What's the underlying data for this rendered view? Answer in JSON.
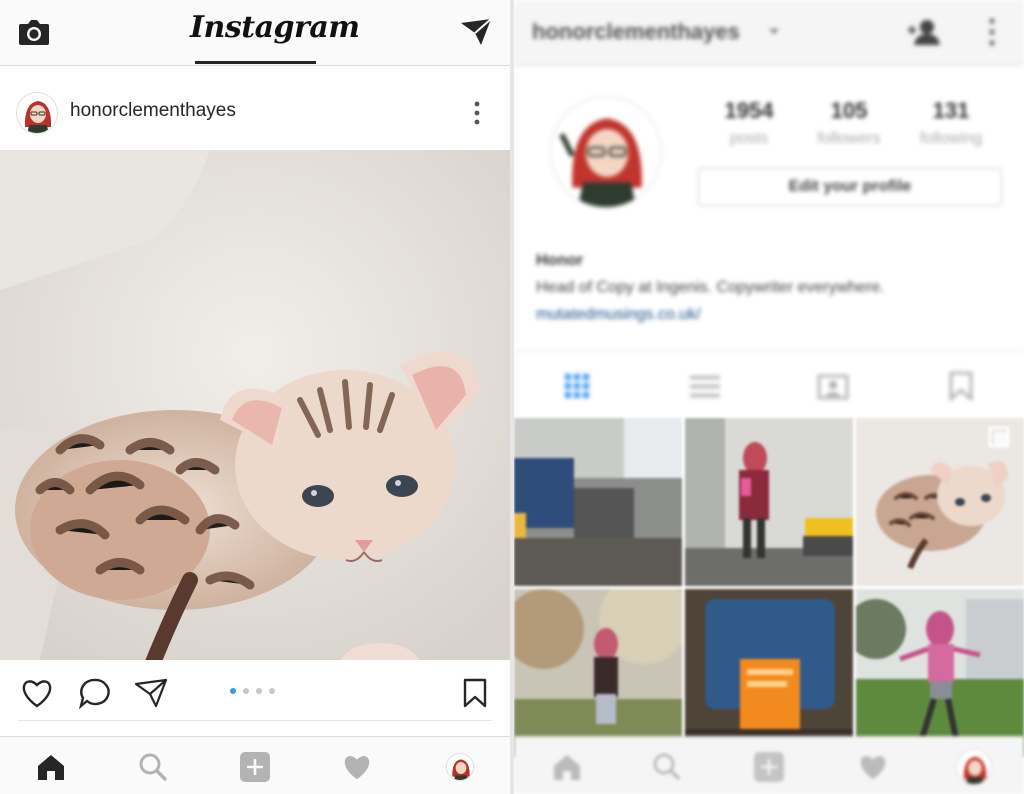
{
  "left_screen": {
    "topbar": {
      "logo_text": "Instagram",
      "left_icon": "camera-icon",
      "right_icon": "direct-send-icon"
    },
    "post": {
      "username": "honorclementhayes",
      "avatar_icon": "profile-avatar",
      "more_icon": "more-vertical-icon",
      "photo_subject": "tabby kitten",
      "actions": [
        "heart-icon",
        "comment-icon",
        "share-icon",
        "bookmark-icon"
      ],
      "carousel": {
        "count": 4,
        "active_index": 0
      }
    },
    "bottom_nav": [
      "home-icon",
      "search-icon",
      "add-icon",
      "heart-icon",
      "profile-avatar"
    ]
  },
  "right_screen": {
    "topbar": {
      "username": "honorclementhayes",
      "dropdown_icon": "chevron-down-icon",
      "add_person_icon": "add-person-icon",
      "more_icon": "more-vertical-icon"
    },
    "stats": [
      {
        "value": "1954",
        "label": "posts"
      },
      {
        "value": "105",
        "label": "followers"
      },
      {
        "value": "131",
        "label": "following"
      }
    ],
    "edit_button": "Edit your profile",
    "bio": {
      "name": "Honor",
      "text": "Head of Copy at Ingenis. Copywriter everywhere.",
      "link": "mutatedmusings.co.uk/"
    },
    "tabs": [
      "grid-icon",
      "list-icon",
      "tagged-icon",
      "bookmark-icon"
    ],
    "colors": {
      "accent": "#3897f0",
      "link": "#1b4f8c",
      "orange_book": "#f28a1e"
    }
  }
}
